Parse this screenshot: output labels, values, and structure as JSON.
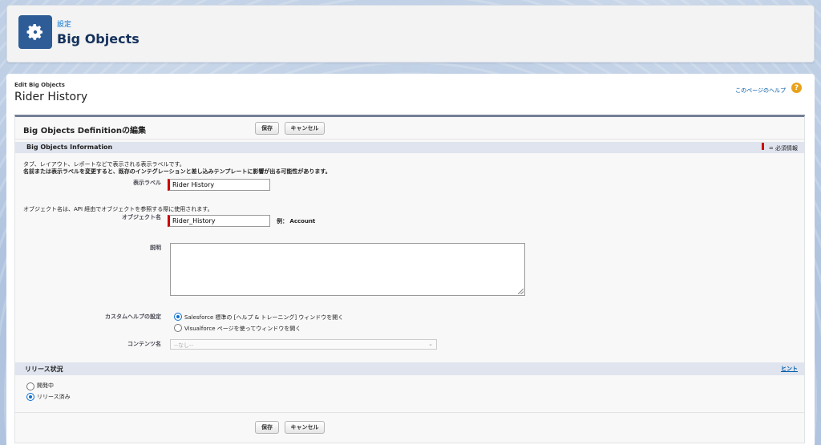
{
  "header": {
    "breadcrumb": "設定",
    "title": "Big Objects",
    "icon": "gear-icon"
  },
  "page": {
    "subtitle": "Edit Big Objects",
    "title": "Rider History",
    "help_link": "このページのヘルプ",
    "help_icon": "question-icon"
  },
  "form": {
    "title": "Big Objects Definitionの編集",
    "save_label": "保存",
    "cancel_label": "キャンセル",
    "section_info": {
      "title": "Big Objects Information",
      "required_legend": "= 必須情報",
      "hint1": "タブ、レイアウト、レポートなどで表示される表示ラベルです。",
      "hint2": "名前または表示ラベルを変更すると、既存のインテグレーションと差し込みテンプレートに影響が出る可能性があります。",
      "display_label_label": "表示ラベル",
      "display_label_value": "Rider History",
      "object_hint": "オブジェクト名は、API 経由でオブジェクトを参照する際に使用されます。",
      "object_name_label": "オブジェクト名",
      "object_name_value": "Rider_History",
      "object_example": "例： Account",
      "description_label": "説明",
      "description_value": "",
      "custom_help_label": "カスタムヘルプの設定",
      "help_option_standard": "Salesforce 標準の [ヘルプ & トレーニング] ウィンドウを開く",
      "help_option_vf": "Visualforce ページを使ってウィンドウを開く",
      "content_name_label": "コンテンツ名",
      "content_name_value": "--なし--"
    },
    "section_release": {
      "title": "リリース状況",
      "hint_link": "ヒント",
      "option_dev": "開発中",
      "option_released": "リリース済み"
    }
  },
  "colors": {
    "accent": "#2e5c96",
    "link": "#015ba7",
    "required": "#cc0000",
    "section_bar": "#dfe4ee"
  }
}
